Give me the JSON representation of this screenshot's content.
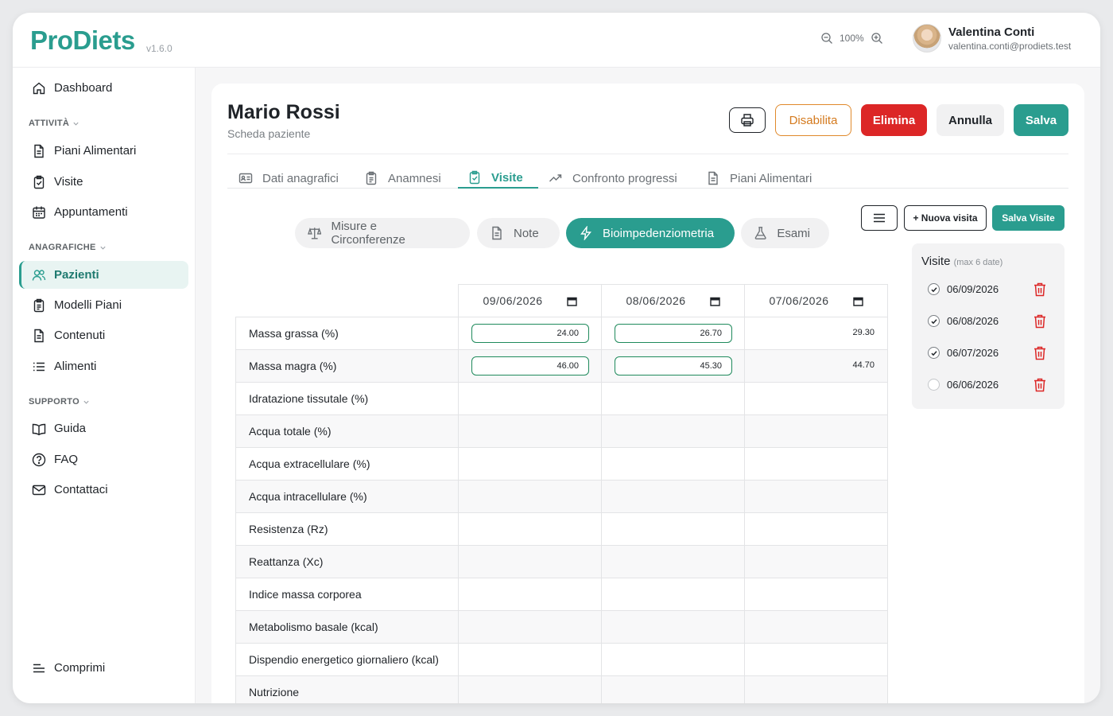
{
  "app": {
    "logo": "ProDiets",
    "version": "v1.6.0"
  },
  "header": {
    "zoom": "100%",
    "user_name": "Valentina Conti",
    "user_email": "valentina.conti@prodiets.test"
  },
  "sidebar": {
    "dashboard": "Dashboard",
    "section_activities": "ATTIVITÀ",
    "activities": [
      "Piani Alimentari",
      "Visite",
      "Appuntamenti"
    ],
    "section_registry": "ANAGRAFICHE",
    "registry": [
      "Pazienti",
      "Modelli Piani",
      "Contenuti",
      "Alimenti"
    ],
    "section_support": "SUPPORTO",
    "support": [
      "Guida",
      "FAQ",
      "Contattaci"
    ],
    "collapse": "Comprimi"
  },
  "patient": {
    "name": "Mario Rossi",
    "subtitle": "Scheda paziente"
  },
  "actions": {
    "disable": "Disabilita",
    "delete": "Elimina",
    "cancel": "Annulla",
    "save": "Salva"
  },
  "tabs": [
    "Dati anagrafici",
    "Anamnesi",
    "Visite",
    "Confronto progressi",
    "Piani Alimentari"
  ],
  "subtabs": [
    "Misure e Circonferenze",
    "Note",
    "Bioimpedenziometria",
    "Esami"
  ],
  "visit_actions": {
    "new_visit": "+ Nuova visita",
    "save_visits": "Salva Visite"
  },
  "visits": {
    "title": "Visite",
    "hint": "(max 6 date)",
    "items": [
      {
        "date": "06/09/2026",
        "checked": true
      },
      {
        "date": "06/08/2026",
        "checked": true
      },
      {
        "date": "06/07/2026",
        "checked": true
      },
      {
        "date": "06/06/2026",
        "checked": false
      }
    ]
  },
  "table": {
    "dates": [
      "09/06/2026",
      "08/06/2026",
      "07/06/2026"
    ],
    "rows": [
      {
        "label": "Massa grassa (%)",
        "values": [
          "24.00",
          "26.70",
          "29.30"
        ]
      },
      {
        "label": "Massa magra (%)",
        "values": [
          "46.00",
          "45.30",
          "44.70"
        ]
      },
      {
        "label": "Idratazione tissutale (%)"
      },
      {
        "label": "Acqua totale (%)"
      },
      {
        "label": "Acqua extracellulare (%)"
      },
      {
        "label": "Acqua intracellulare (%)"
      },
      {
        "label": "Resistenza (Rz)"
      },
      {
        "label": "Reattanza (Xc)"
      },
      {
        "label": "Indice massa corporea"
      },
      {
        "label": "Metabolismo basale (kcal)"
      },
      {
        "label": "Dispendio energetico giornaliero (kcal)"
      },
      {
        "label": "Nutrizione"
      }
    ]
  }
}
